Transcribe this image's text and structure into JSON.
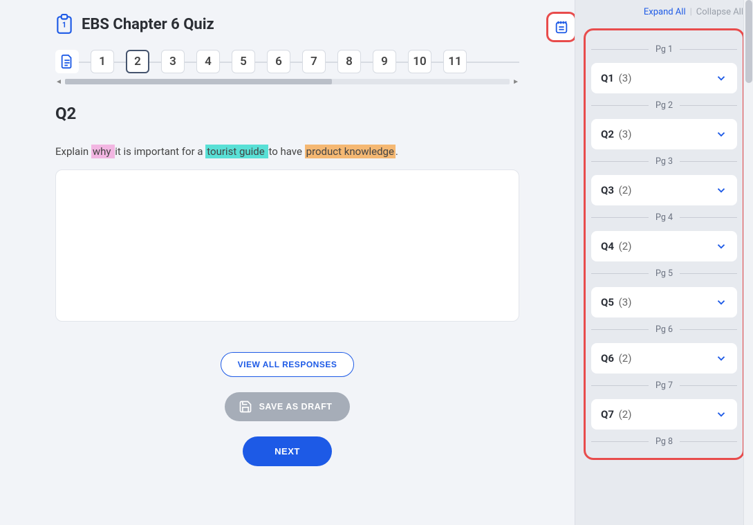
{
  "header": {
    "title": "EBS Chapter 6 Quiz"
  },
  "pager": {
    "items": [
      "1",
      "2",
      "3",
      "4",
      "5",
      "6",
      "7",
      "8",
      "9",
      "10",
      "11"
    ],
    "active_index": 1
  },
  "question": {
    "heading": "Q2",
    "text_parts": {
      "p1": "Explain ",
      "hl1": "why ",
      "p2": "it is important for a ",
      "hl2": "tourist guide ",
      "p3": "to have ",
      "hl3": "product knowledge",
      "p4": "."
    },
    "answer_value": ""
  },
  "buttons": {
    "view_all": "VIEW ALL RESPONSES",
    "save_draft": "SAVE AS DRAFT",
    "next": "NEXT"
  },
  "sidebar": {
    "expand": "Expand All",
    "collapse": "Collapse All",
    "sections": [
      {
        "pg": "Pg 1",
        "q": "Q1",
        "count": "(3)"
      },
      {
        "pg": "Pg 2",
        "q": "Q2",
        "count": "(3)"
      },
      {
        "pg": "Pg 3",
        "q": "Q3",
        "count": "(2)"
      },
      {
        "pg": "Pg 4",
        "q": "Q4",
        "count": "(2)"
      },
      {
        "pg": "Pg 5",
        "q": "Q5",
        "count": "(3)"
      },
      {
        "pg": "Pg 6",
        "q": "Q6",
        "count": "(2)"
      },
      {
        "pg": "Pg 7",
        "q": "Q7",
        "count": "(2)"
      },
      {
        "pg": "Pg 8",
        "q": "",
        "count": ""
      }
    ]
  }
}
